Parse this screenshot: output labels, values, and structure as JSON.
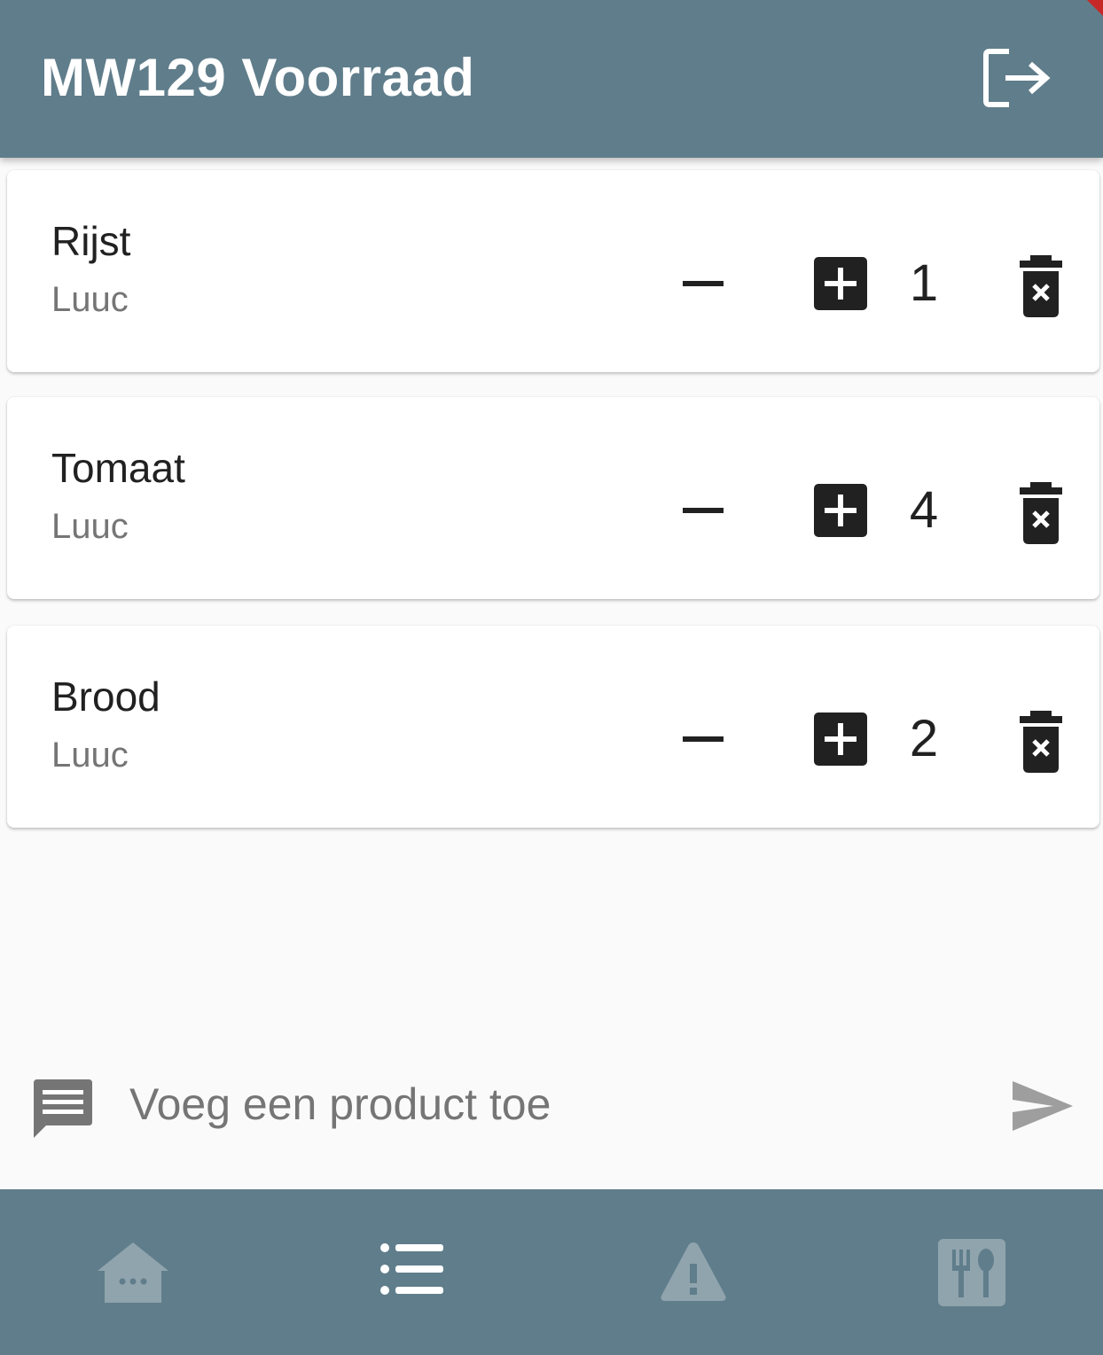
{
  "appbar": {
    "title": "MW129 Voorraad",
    "logout_icon": "logout-icon"
  },
  "products": [
    {
      "name": "Rijst",
      "owner": "Luuc",
      "quantity": "1"
    },
    {
      "name": "Tomaat",
      "owner": "Luuc",
      "quantity": "4"
    },
    {
      "name": "Brood",
      "owner": "Luuc",
      "quantity": "2"
    }
  ],
  "composer": {
    "placeholder": "Voeg een product toe",
    "value": ""
  },
  "bottom_nav": {
    "items": [
      {
        "icon": "home-icon"
      },
      {
        "icon": "list-icon",
        "active": true
      },
      {
        "icon": "warning-icon"
      },
      {
        "icon": "restaurant-menu-icon"
      }
    ]
  },
  "colors": {
    "primary": "#607d8b",
    "nav_inactive_icon": "#90a4ae",
    "nav_active_icon": "#ffffff",
    "background": "#fafafa",
    "card": "#ffffff",
    "text_primary": "#212121",
    "text_secondary": "#757575"
  }
}
